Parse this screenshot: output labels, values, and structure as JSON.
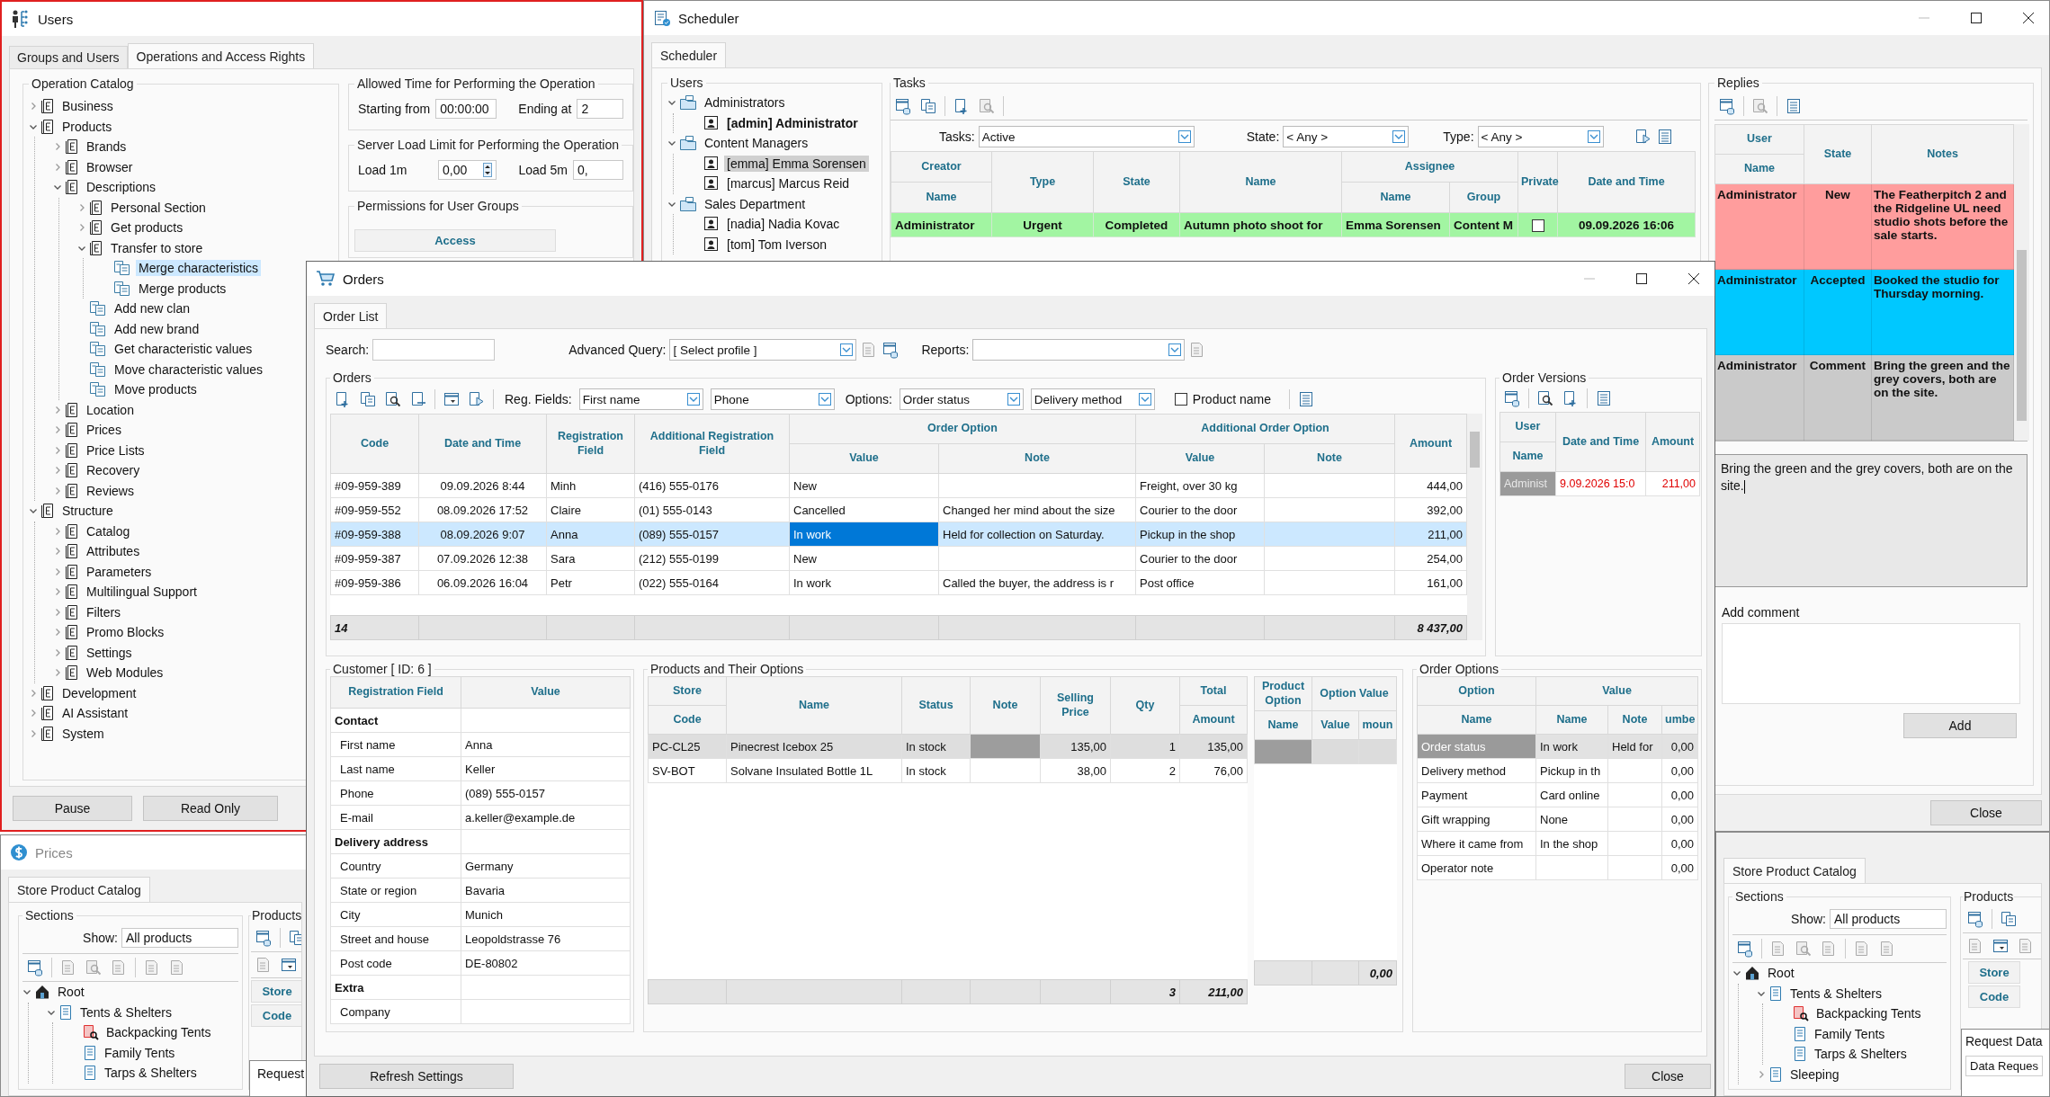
{
  "users_window": {
    "title": "Users",
    "tabs": [
      {
        "label": "Groups and Users",
        "selected": false
      },
      {
        "label": "Operations and Access Rights",
        "selected": true
      }
    ],
    "operation_catalog": {
      "title": "Operation Catalog",
      "tree": [
        {
          "label": "Business",
          "kind": "section",
          "expanded": false,
          "selected": false
        },
        {
          "label": "Products",
          "kind": "section",
          "expanded": true,
          "selected": false,
          "children": [
            {
              "label": "Brands",
              "kind": "section",
              "expanded": false,
              "selected": false
            },
            {
              "label": "Browser",
              "kind": "section",
              "expanded": false,
              "selected": false
            },
            {
              "label": "Descriptions",
              "kind": "section",
              "expanded": true,
              "selected": false,
              "children": [
                {
                  "label": "Personal Section",
                  "kind": "section",
                  "expanded": false,
                  "selected": false
                },
                {
                  "label": "Get products",
                  "kind": "section",
                  "expanded": false,
                  "selected": false
                },
                {
                  "label": "Transfer to store",
                  "kind": "section",
                  "expanded": true,
                  "selected": false,
                  "children": [
                    {
                      "label": "Merge characteristics",
                      "kind": "operation",
                      "selected": true
                    },
                    {
                      "label": "Merge products",
                      "kind": "operation",
                      "selected": false
                    }
                  ]
                },
                {
                  "label": "Add new clan",
                  "kind": "operation",
                  "selected": false
                },
                {
                  "label": "Add new brand",
                  "kind": "operation",
                  "selected": false
                },
                {
                  "label": "Get characteristic values",
                  "kind": "operation",
                  "selected": false
                },
                {
                  "label": "Move characteristic values",
                  "kind": "operation",
                  "selected": false
                },
                {
                  "label": "Move products",
                  "kind": "operation",
                  "selected": false
                }
              ]
            },
            {
              "label": "Location",
              "kind": "section",
              "expanded": false,
              "selected": false
            },
            {
              "label": "Prices",
              "kind": "section",
              "expanded": false,
              "selected": false
            },
            {
              "label": "Price Lists",
              "kind": "section",
              "expanded": false,
              "selected": false
            },
            {
              "label": "Recovery",
              "kind": "section",
              "expanded": false,
              "selected": false
            },
            {
              "label": "Reviews",
              "kind": "section",
              "expanded": false,
              "selected": false
            }
          ]
        },
        {
          "label": "Structure",
          "kind": "section",
          "expanded": true,
          "selected": false,
          "children": [
            {
              "label": "Catalog",
              "kind": "section",
              "expanded": false,
              "selected": false
            },
            {
              "label": "Attributes",
              "kind": "section",
              "expanded": false,
              "selected": false
            },
            {
              "label": "Parameters",
              "kind": "section",
              "expanded": false,
              "selected": false
            },
            {
              "label": "Multilingual Support",
              "kind": "section",
              "expanded": false,
              "selected": false
            },
            {
              "label": "Filters",
              "kind": "section",
              "expanded": false,
              "selected": false
            },
            {
              "label": "Promo Blocks",
              "kind": "section",
              "expanded": false,
              "selected": false
            },
            {
              "label": "Settings",
              "kind": "section",
              "expanded": false,
              "selected": false
            },
            {
              "label": "Web Modules",
              "kind": "section",
              "expanded": false,
              "selected": false
            }
          ]
        },
        {
          "label": "Development",
          "kind": "section",
          "expanded": false,
          "selected": false
        },
        {
          "label": "AI Assistant",
          "kind": "section",
          "expanded": false,
          "selected": false
        },
        {
          "label": "System",
          "kind": "section",
          "expanded": false,
          "selected": false
        }
      ]
    },
    "allowed_time": {
      "title": "Allowed Time for Performing the Operation",
      "start_label": "Starting from",
      "start_value": "00:00:00",
      "end_label": "Ending at",
      "end_value": "2"
    },
    "server_load": {
      "title": "Server Load Limit for Performing the Operation",
      "load_1m_label": "Load 1m",
      "load_1m_value": "0,00",
      "load_5m_label": "Load 5m",
      "load_5m_value": "0,"
    },
    "permissions": {
      "title": "Permissions for User Groups",
      "columns": [
        "Access"
      ]
    },
    "buttons": [
      "Pause",
      "Read Only"
    ]
  },
  "scheduler_window": {
    "title": "Scheduler",
    "tabs": [
      {
        "label": "Scheduler",
        "selected": true
      }
    ],
    "users": {
      "title": "Users",
      "tree": [
        {
          "label": "Administrators",
          "kind": "group",
          "expanded": true,
          "selected": false,
          "children": [
            {
              "label": "[admin] Administrator",
              "kind": "user",
              "current": true,
              "selected": false
            }
          ]
        },
        {
          "label": "Content Managers",
          "kind": "group",
          "expanded": true,
          "selected": false,
          "children": [
            {
              "label": "[emma] Emma Sorensen",
              "kind": "user",
              "current": false,
              "selected": true
            },
            {
              "label": "[marcus] Marcus Reid",
              "kind": "user",
              "current": false,
              "selected": false
            }
          ]
        },
        {
          "label": "Sales Department",
          "kind": "group",
          "expanded": true,
          "selected": false,
          "children": [
            {
              "label": "[nadia] Nadia Kovac",
              "kind": "user",
              "current": false,
              "selected": false
            },
            {
              "label": "[tom] Tom Iverson",
              "kind": "user",
              "current": false,
              "selected": false
            }
          ]
        }
      ]
    },
    "tasks": {
      "title": "Tasks",
      "filters": [
        {
          "label": "Tasks:",
          "value": "Active"
        },
        {
          "label": "State:",
          "value": "< Any >"
        },
        {
          "label": "Type:",
          "value": "< Any >"
        }
      ],
      "columns": [
        {
          "group": "Creator",
          "columns": [
            {
              "label": "Name"
            }
          ]
        },
        {
          "label": "Type"
        },
        {
          "label": "State"
        },
        {
          "label": "Name"
        },
        {
          "group": "Assignee",
          "colspan": 2,
          "columns": [
            {
              "label": "Name"
            },
            {
              "label": "Group"
            }
          ]
        },
        {
          "label": "Private"
        },
        {
          "label": "Date and Time"
        }
      ],
      "rows": [
        {
          "cells": [
            "Administrator",
            "Urgent",
            "Completed",
            "Autumn photo shoot for",
            "Emma Sorensen",
            "Content M"
          ],
          "private": false,
          "date": "09.09.2026 16:06",
          "color": "#a2f5a2"
        }
      ]
    },
    "replies": {
      "title": "Replies",
      "columns": [
        {
          "group": "User",
          "columns": [
            {
              "label": "Name"
            }
          ]
        },
        {
          "label": "State"
        },
        {
          "label": "Notes"
        }
      ],
      "rows": [
        {
          "cells": [
            "Administrator",
            "New",
            "The Featherpitch 2 and the Ridgeline UL need studio shots before the sale starts."
          ],
          "color": "#ff9d9d"
        },
        {
          "cells": [
            "Administrator",
            "Accepted",
            "Booked the studio for Thursday morning."
          ],
          "color": "#00c8ff"
        },
        {
          "cells": [
            "Administrator",
            "Comment",
            "Bring the green and the grey covers, both are on the site."
          ],
          "color": "#cacaca"
        }
      ]
    },
    "reply_text": "Bring the green and the grey covers, both are on the site.",
    "add_comment": {
      "label": "Add comment",
      "button": "Add"
    },
    "close_button": "Close"
  },
  "orders_window": {
    "title": "Orders",
    "tabs": [
      {
        "label": "Order List",
        "selected": true
      }
    ],
    "search": {
      "label": "Search:"
    },
    "advanced_query": {
      "label": "Advanced Query:",
      "value": "[ Select profile ]"
    },
    "reports": {
      "label": "Reports:"
    },
    "orders": {
      "title": "Orders",
      "reg_fields_label": "Reg. Fields:",
      "reg_fields": [
        "First name",
        "Phone"
      ],
      "options_label": "Options:",
      "options": [
        "Order status",
        "Delivery method"
      ],
      "product_name": {
        "label": "Product name",
        "checked": false
      },
      "columns": [
        {
          "label": "Code",
          "current": false
        },
        {
          "label": "Date and Time",
          "current": false
        },
        {
          "label": "Registration Field",
          "current": false
        },
        {
          "label": "Additional Registration Field",
          "current": false
        },
        {
          "group": "Order Option",
          "colspan": 2,
          "columns": [
            {
              "label": "Value",
              "current": true
            },
            {
              "label": "Note",
              "current": false
            }
          ]
        },
        {
          "group": "Additional Order Option",
          "colspan": 2,
          "columns": [
            {
              "label": "Value",
              "current": false
            },
            {
              "label": "Note",
              "current": false
            }
          ]
        },
        {
          "label": "Amount",
          "current": false
        }
      ],
      "rows": [
        {
          "cells": [
            "#09-959-389",
            "09.09.2026 8:44",
            "Minh",
            "(416) 555-0176",
            "New",
            null,
            "Freight, over 30 kg",
            null,
            "444,00"
          ],
          "selected": false
        },
        {
          "cells": [
            "#09-959-552",
            "08.09.2026 17:52",
            "Claire",
            "(01) 555-0143",
            "Cancelled",
            "Changed her mind about the size",
            "Courier to the door",
            null,
            "392,00"
          ],
          "selected": false
        },
        {
          "cells": [
            "#09-959-388",
            "08.09.2026 9:07",
            "Anna",
            "(089) 555-0157",
            "In work",
            "Held for collection on Saturday.",
            "Pickup in the shop",
            null,
            "211,00"
          ],
          "selected": true
        },
        {
          "cells": [
            "#09-959-387",
            "07.09.2026 12:38",
            "Sara",
            "(212) 555-0199",
            "New",
            null,
            "Courier to the door",
            null,
            "254,00"
          ],
          "selected": false
        },
        {
          "cells": [
            "#09-959-386",
            "06.09.2026 16:04",
            "Petr",
            "(022) 555-0164",
            "In work",
            "Called the buyer, the address is r",
            "Post office",
            null,
            "161,00"
          ],
          "selected": false
        }
      ],
      "totals": {
        "count": "14",
        "amount": "8 437,00"
      }
    },
    "order_versions": {
      "title": "Order Versions",
      "columns": [
        {
          "group": "User",
          "columns": [
            {
              "label": "Name"
            }
          ]
        },
        {
          "label": "Date and Time"
        },
        {
          "label": "Amount"
        }
      ],
      "rows": [
        {
          "cells": [
            "Administ",
            "9.09.2026 15:0",
            "211,00"
          ],
          "selected": true
        }
      ]
    },
    "customer": {
      "title": "Customer [ ID: 6 ]",
      "columns": [
        "Registration Field",
        "Value"
      ],
      "rows": [
        {
          "kind": "section",
          "label": "Contact"
        },
        {
          "kind": "field",
          "label": "First name",
          "value": "Anna"
        },
        {
          "kind": "field",
          "label": "Last name",
          "value": "Keller"
        },
        {
          "kind": "field",
          "label": "Phone",
          "value": "(089) 555-0157"
        },
        {
          "kind": "field",
          "label": "E-mail",
          "value": "a.keller@example.de"
        },
        {
          "kind": "section",
          "label": "Delivery address"
        },
        {
          "kind": "field",
          "label": "Country",
          "value": "Germany"
        },
        {
          "kind": "field",
          "label": "State or region",
          "value": "Bavaria"
        },
        {
          "kind": "field",
          "label": "City",
          "value": "Munich"
        },
        {
          "kind": "field",
          "label": "Street and house",
          "value": "Leopoldstrasse 76"
        },
        {
          "kind": "field",
          "label": "Post code",
          "value": "DE-80802"
        },
        {
          "kind": "section",
          "label": "Extra"
        },
        {
          "kind": "field",
          "label": "Company"
        }
      ]
    },
    "products": {
      "title": "Products and Their Options",
      "columns": [
        {
          "group": "Store",
          "columns": [
            {
              "label": "Code",
              "current": false
            }
          ]
        },
        {
          "label": "Name",
          "current": false
        },
        {
          "label": "Status",
          "current": false
        },
        {
          "label": "Note",
          "current": true
        },
        {
          "label": "Selling Price",
          "current": false
        },
        {
          "label": "Qty",
          "current": false
        },
        {
          "group": "Total",
          "columns": [
            {
              "label": "Amount",
              "current": false
            }
          ]
        }
      ],
      "rows": [
        {
          "cells": [
            "PC-CL25",
            "Pinecrest Icebox 25",
            "In stock",
            null,
            "135,00",
            "1",
            "135,00"
          ],
          "selected": true
        },
        {
          "cells": [
            "SV-BOT",
            "Solvane Insulated Bottle 1L",
            "In stock",
            null,
            "38,00",
            "2",
            "76,00"
          ],
          "selected": false
        }
      ],
      "totals": {
        "qty": "3",
        "amount": "211,00"
      },
      "option_columns": [
        {
          "group": "Product Option",
          "columns": [
            {
              "label": "Name"
            }
          ]
        },
        {
          "group": "Option Value",
          "colspan": 2,
          "columns": [
            {
              "label": "Value"
            },
            {
              "label": "moun"
            }
          ]
        }
      ],
      "option_total": "0,00"
    },
    "order_options": {
      "title": "Order Options",
      "columns": [
        {
          "group": "Option",
          "columns": [
            {
              "label": "Name"
            }
          ]
        },
        {
          "group": "Value",
          "colspan": 3,
          "columns": [
            {
              "label": "Name"
            },
            {
              "label": "Note"
            },
            {
              "label": "umbe"
            }
          ]
        }
      ],
      "rows": [
        {
          "cells": [
            "Order status",
            "In work",
            "Held for",
            "0,00"
          ],
          "selected": true
        },
        {
          "cells": [
            "Delivery method",
            "Pickup in th",
            null,
            "0,00"
          ],
          "selected": false
        },
        {
          "cells": [
            "Payment",
            "Card online",
            null,
            "0,00"
          ],
          "selected": false
        },
        {
          "cells": [
            "Gift wrapping",
            "None",
            null,
            "0,00"
          ],
          "selected": false
        },
        {
          "cells": [
            "Where it came from",
            "In the shop",
            null,
            "0,00"
          ],
          "selected": false
        },
        {
          "cells": [
            "Operator note",
            null,
            null,
            "0,00"
          ],
          "selected": false
        }
      ]
    },
    "buttons": {
      "refresh": "Refresh Settings",
      "close": "Close"
    }
  },
  "prices_window": {
    "title": "Prices",
    "tabs": [
      {
        "label": "Store Product Catalog",
        "selected": true
      }
    ],
    "sections": {
      "title": "Sections",
      "show_label": "Show:",
      "show_value": "All products",
      "tree": [
        {
          "label": "Root",
          "kind": "root",
          "expanded": true,
          "selected": false,
          "children": [
            {
              "label": "Tents & Shelters",
              "kind": "category",
              "expanded": true,
              "selected": false,
              "children": [
                {
                  "label": "Backpacking Tents",
                  "kind": "filtered",
                  "selected": false
                },
                {
                  "label": "Family Tents",
                  "kind": "category",
                  "selected": false
                },
                {
                  "label": "Tarps & Shelters",
                  "kind": "category",
                  "selected": false
                }
              ]
            }
          ]
        }
      ]
    },
    "products": {
      "title": "Products",
      "columns": [
        "Store",
        "Code"
      ]
    },
    "request_window": {
      "title": "Request"
    }
  },
  "catalog_window": {
    "tabs": [
      {
        "label": "Store Product Catalog",
        "selected": true
      }
    ],
    "sections": {
      "title": "Sections",
      "show_label": "Show:",
      "show_value": "All products",
      "tree": [
        {
          "label": "Root",
          "kind": "root",
          "expanded": true,
          "selected": false,
          "children": [
            {
              "label": "Tents & Shelters",
              "kind": "category",
              "expanded": true,
              "selected": false,
              "children": [
                {
                  "label": "Backpacking Tents",
                  "kind": "filtered",
                  "selected": false
                },
                {
                  "label": "Family Tents",
                  "kind": "category",
                  "selected": false
                },
                {
                  "label": "Tarps & Shelters",
                  "kind": "category",
                  "selected": false
                }
              ]
            },
            {
              "label": "Sleeping",
              "kind": "category",
              "expanded": false,
              "selected": false
            }
          ]
        }
      ]
    },
    "products": {
      "title": "Products",
      "columns": [
        "Store",
        "Code"
      ]
    },
    "request_window": {
      "title": "Request Data",
      "tab": "Data Reques"
    }
  }
}
